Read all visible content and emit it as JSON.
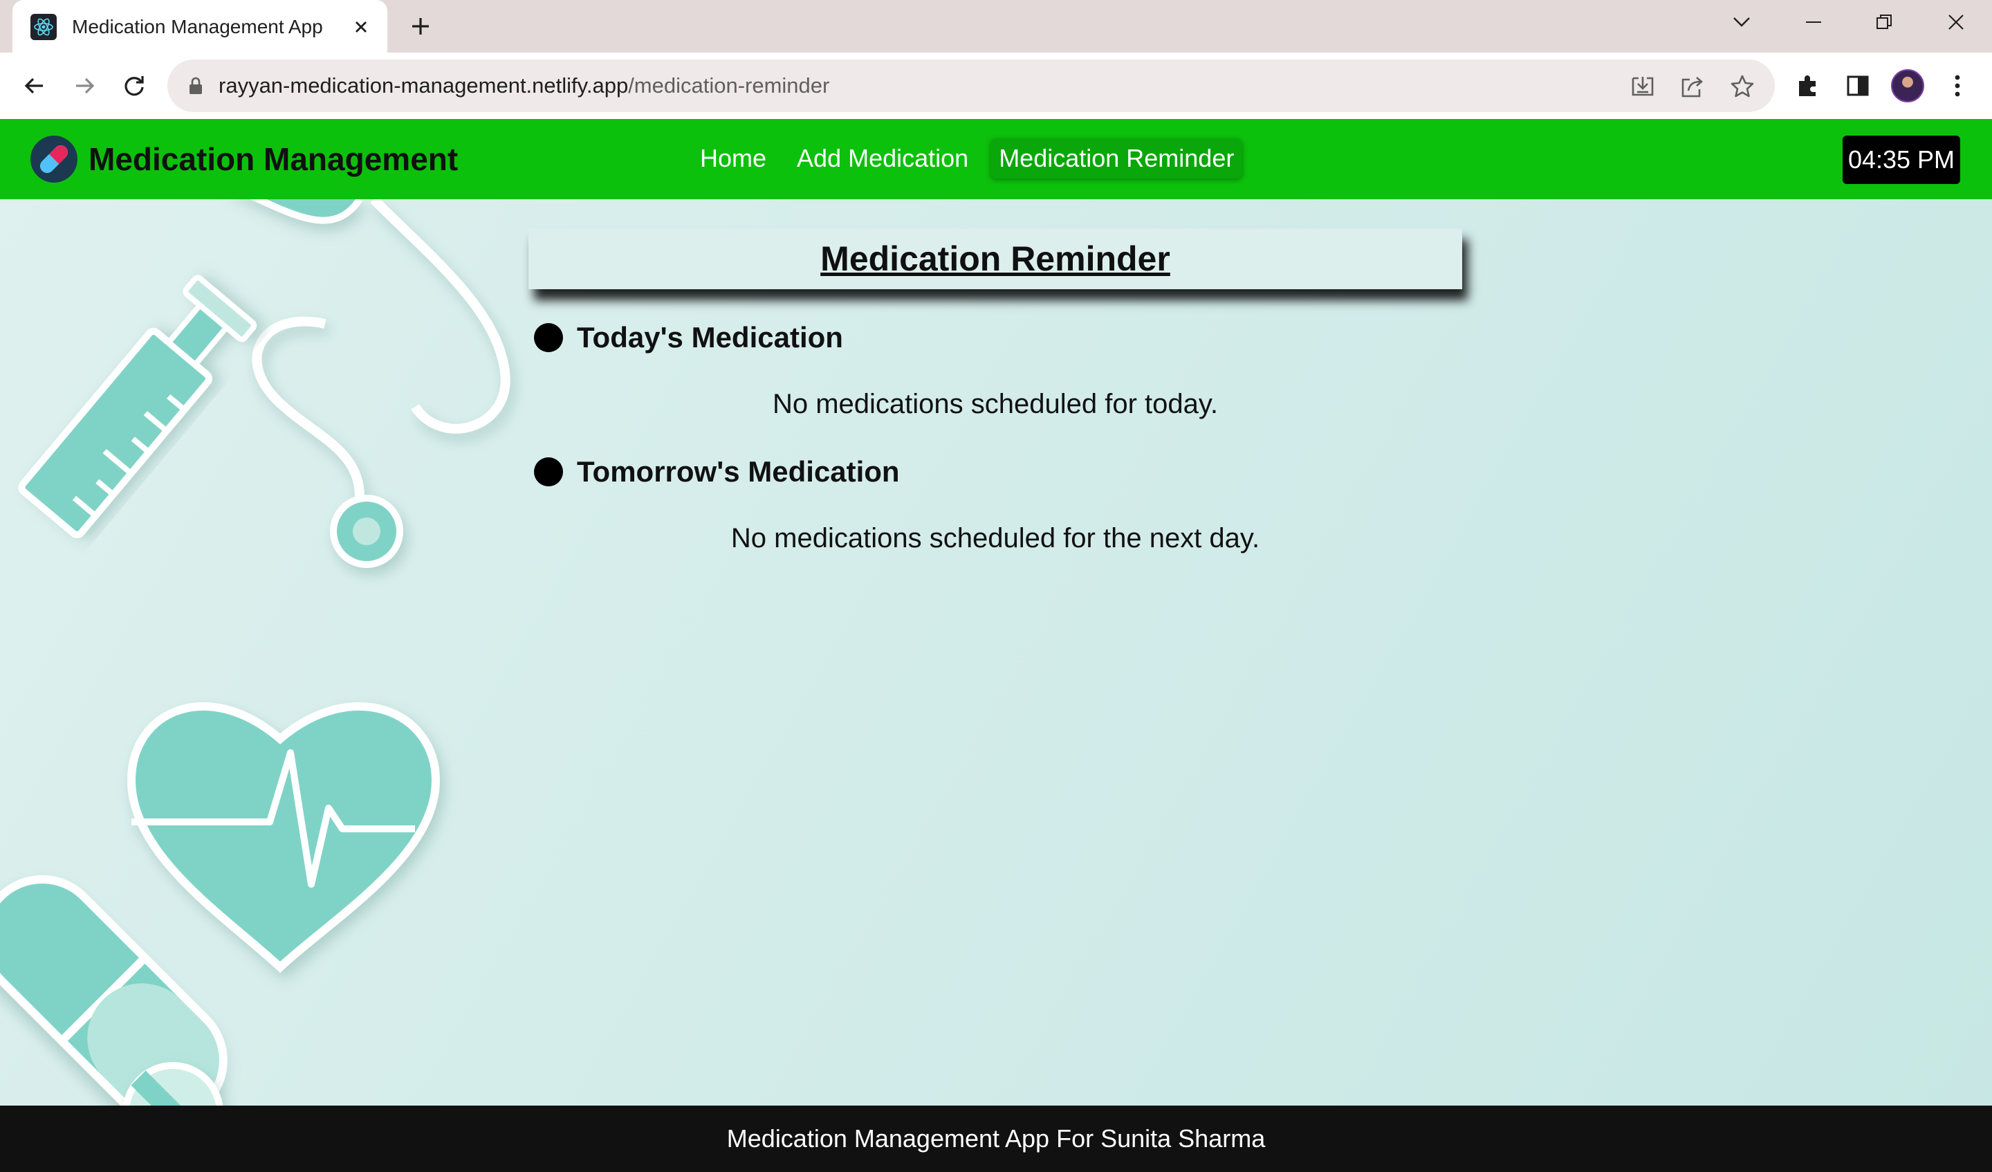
{
  "browser": {
    "tab_title": "Medication Management App",
    "url_host": "rayyan-medication-management.netlify.app",
    "url_path": "/medication-reminder",
    "icons": [
      "react-favicon-icon",
      "close-icon",
      "plus-icon",
      "chevron-down-icon",
      "minimize-icon",
      "restore-icon",
      "close-window-icon",
      "back-arrow-icon",
      "forward-arrow-icon",
      "reload-icon",
      "lock-icon",
      "install-icon",
      "share-icon",
      "star-icon",
      "extensions-icon",
      "side-panel-icon",
      "more-vertical-icon"
    ]
  },
  "navbar": {
    "brand": "Medication Management",
    "links": [
      {
        "label": "Home",
        "active": false
      },
      {
        "label": "Add Medication",
        "active": false
      },
      {
        "label": "Medication Reminder",
        "active": true
      }
    ],
    "clock": "04:35 PM",
    "color": "#0cc10c"
  },
  "main": {
    "title": "Medication Reminder",
    "sections": [
      {
        "label": "Today's Medication",
        "empty_message": "No medications scheduled for today."
      },
      {
        "label": "Tomorrow's Medication",
        "empty_message": "No medications scheduled for the next day."
      }
    ]
  },
  "footer": {
    "text": "Medication Management App For Sunita Sharma"
  }
}
